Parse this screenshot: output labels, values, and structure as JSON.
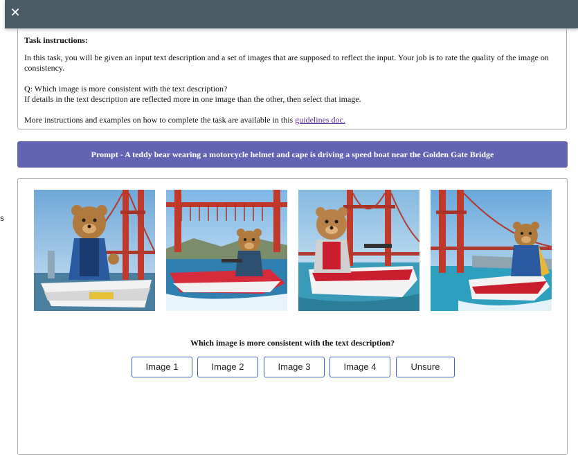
{
  "header": {
    "close_label": "✕"
  },
  "side_glyph": "s",
  "instructions": {
    "title": "Task instructions:",
    "para1": "In this task, you will be given an input text description and a set of images that are supposed to reflect the input. Your job is to rate the quality of the image on consistency.",
    "q_line": "Q: Which image is more consistent with the text description?",
    "detail_line": "If details in the text description are reflected more in one image than the other, then select that image.",
    "more_prefix": "More instructions and examples on how to complete the task are available in this ",
    "link_text": "guidelines doc."
  },
  "prompt": {
    "text": "Prompt - A teddy bear wearing a motorcycle helmet and cape is driving a speed boat near the Golden Gate Bridge"
  },
  "question": "Which image is more consistent with the text description?",
  "choices": [
    "Image 1",
    "Image 2",
    "Image 3",
    "Image 4",
    "Unsure"
  ],
  "colors": {
    "topbar": "#4b5b66",
    "prompt_bg": "#6363b4",
    "button_border": "#3d63b8",
    "link": "#5b2d8e",
    "bridge": "#c0392b"
  }
}
